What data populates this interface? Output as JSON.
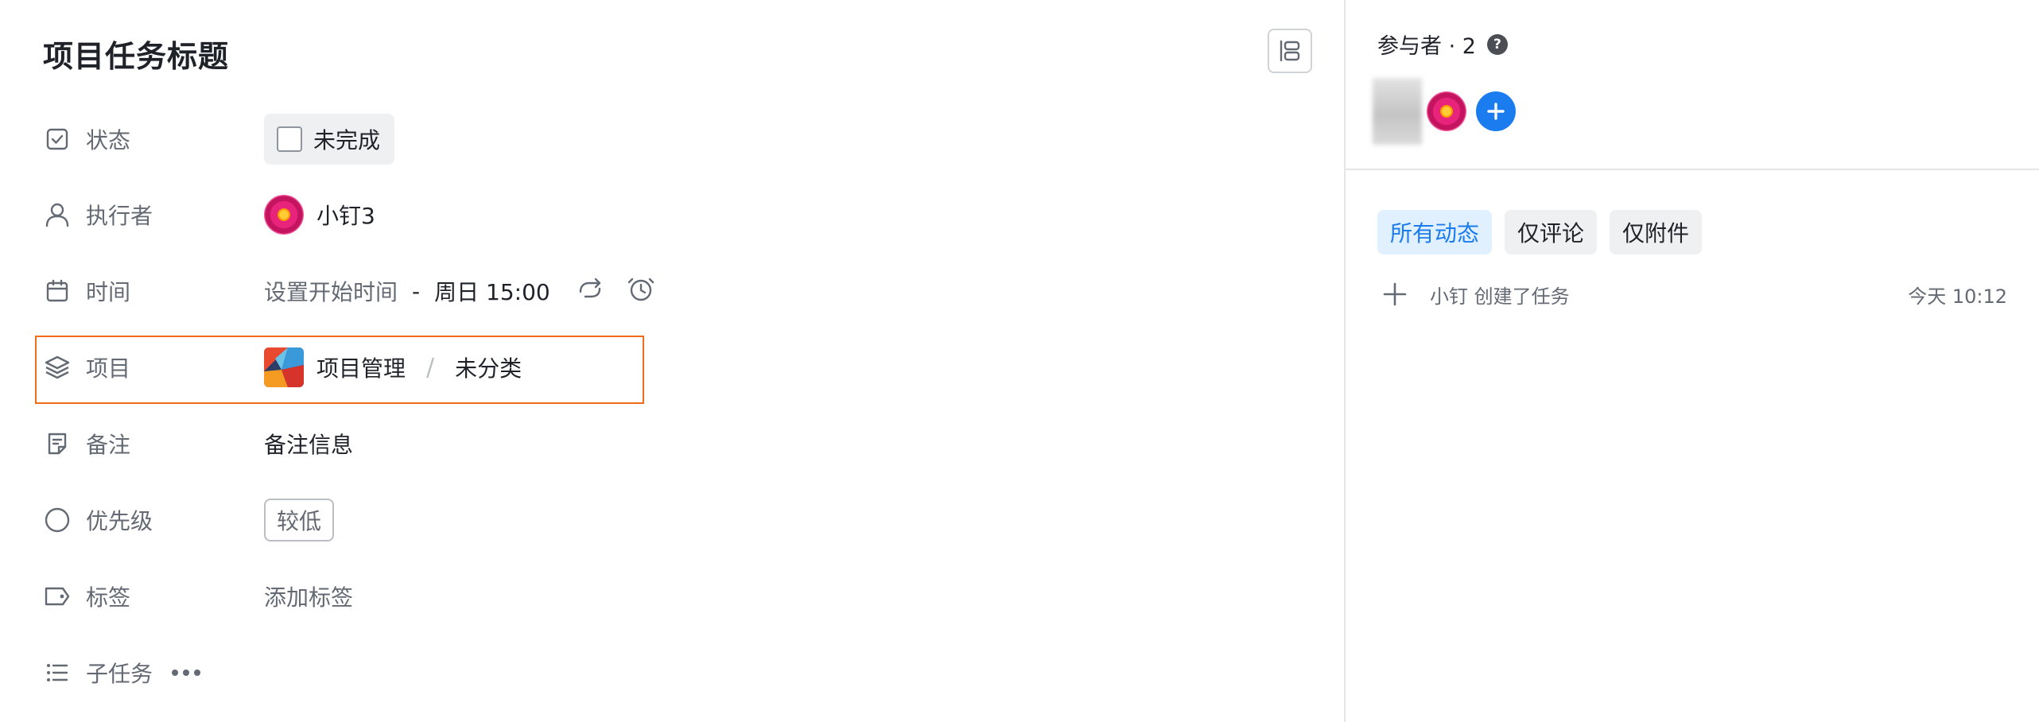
{
  "task": {
    "title": "项目任务标题",
    "layout_toggle_icon": "layout-icon"
  },
  "fields": {
    "status": {
      "label": "状态",
      "icon": "checkbox-icon",
      "value": "未完成"
    },
    "assignee": {
      "label": "执行者",
      "icon": "user-icon",
      "value": "小钉3",
      "avatar": "flower-avatar"
    },
    "time": {
      "label": "时间",
      "icon": "calendar-icon",
      "start_placeholder": "设置开始时间",
      "separator": "-",
      "end": "周日 15:00",
      "repeat_icon": "repeat-icon",
      "reminder_icon": "alarm-clock-icon"
    },
    "project": {
      "label": "项目",
      "icon": "layers-icon",
      "name": "项目管理",
      "separator": "/",
      "category": "未分类"
    },
    "note": {
      "label": "备注",
      "icon": "note-icon",
      "value": "备注信息"
    },
    "priority": {
      "label": "优先级",
      "icon": "circle-icon",
      "value": "较低"
    },
    "tags": {
      "label": "标签",
      "icon": "tag-icon",
      "placeholder": "添加标签"
    },
    "subtasks": {
      "label": "子任务",
      "icon": "list-icon",
      "more_icon": "more-icon"
    }
  },
  "participants": {
    "title": "参与者 · 2",
    "help_icon": "?",
    "add_icon": "plus-icon"
  },
  "activity": {
    "tabs": [
      {
        "label": "所有动态",
        "active": true
      },
      {
        "label": "仅评论",
        "active": false
      },
      {
        "label": "仅附件",
        "active": false
      }
    ],
    "items": [
      {
        "text": "小钉 创建了任务",
        "time": "今天 10:12",
        "icon": "plus-icon"
      }
    ]
  },
  "colors": {
    "accent": "#1b7cf0",
    "highlight_border": "#f26b1d",
    "muted_text": "#646a73"
  }
}
